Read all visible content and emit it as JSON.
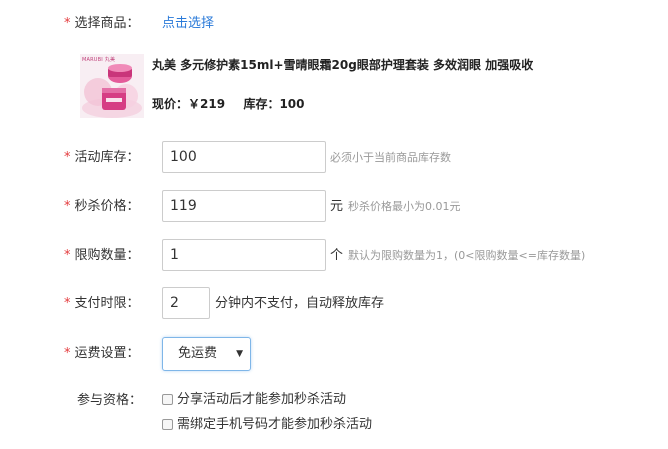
{
  "product": {
    "label": "选择商品：",
    "select_link": "点击选择",
    "thumb_brand": "MARUBI 丸美",
    "title": "丸美 多元修护素15ml+雪晴眼霜20g眼部护理套装 多效润眼 加强吸收",
    "price_label": "现价：￥219",
    "stock_label": "库存：100"
  },
  "activity_stock": {
    "label": "活动库存：",
    "value": "100",
    "hint": "必须小于当前商品库存数"
  },
  "seckill_price": {
    "label": "秒杀价格：",
    "value": "119",
    "unit": "元",
    "hint": "秒杀价格最小为0.01元"
  },
  "purchase_limit": {
    "label": "限购数量：",
    "value": "1",
    "unit": "个",
    "hint": "默认为限购数量为1，(0<限购数量<=库存数量)"
  },
  "payment_limit": {
    "label": "支付时限：",
    "value": "2",
    "unit": "分钟内不支付，自动释放库存"
  },
  "shipping": {
    "label": "运费设置：",
    "selected": "免运费"
  },
  "eligibility": {
    "label": "参与资格：",
    "options": [
      {
        "label": "分享活动后才能参加秒杀活动",
        "checked": false
      },
      {
        "label": "需绑定手机号码才能参加秒杀活动",
        "checked": false
      }
    ]
  },
  "colors": {
    "required": "#e4393c",
    "link": "#2a7ad9",
    "hint": "#999999",
    "select_border": "#7fb6e8"
  },
  "icons": {
    "select_arrow": "caret-down-icon"
  }
}
